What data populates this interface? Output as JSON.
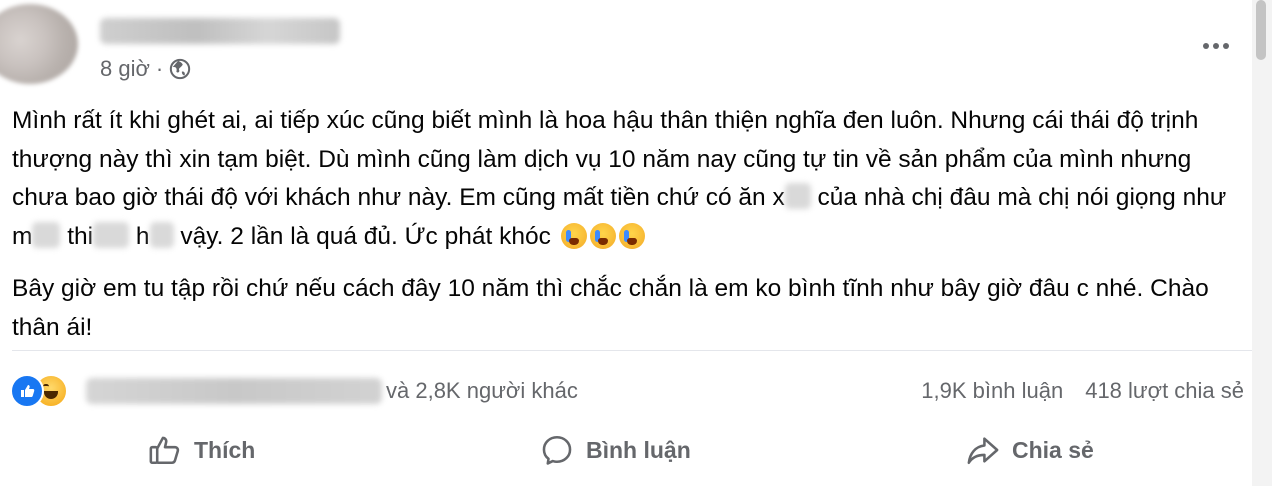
{
  "post": {
    "time": "8 giờ",
    "dot": "·",
    "paragraphs": {
      "p1a": "Mình rất ít khi ghét ai, ai tiếp xúc cũng biết mình là hoa hậu thân thiện nghĩa đen luôn. Nhưng cái thái độ trịnh thượng này thì xin tạm biệt. Dù mình cũng làm dịch vụ 10 năm nay cũng tự tin về sản phẩm của mình nhưng chưa bao giờ thái độ với khách như này. Em cũng mất tiền chứ có ăn x",
      "p1b": " của nhà chị đâu mà chị nói giọng như m",
      "p1c": " thi",
      "p1d": " h",
      "p1e": " vậy. 2 lần là quá đủ. Ức phát khóc",
      "p2": "Bây giờ em tu tập rồi chứ nếu cách đây 10 năm thì chắc chắn là em ko bình tĩnh như bây giờ đâu c nhé. Chào thân ái!"
    }
  },
  "reactions": {
    "others": "và 2,8K người khác",
    "comments": "1,9K bình luận",
    "shares": "418 lượt chia sẻ"
  },
  "actions": {
    "like": "Thích",
    "comment": "Bình luận",
    "share": "Chia sẻ"
  },
  "icons": {
    "globe": "globe-icon",
    "more": "more-icon",
    "like": "like-icon",
    "haha": "haha-icon",
    "cry": "crying-emoji-icon"
  },
  "colors": {
    "facebook_blue": "#1877f2",
    "secondary_text": "#65676b",
    "primary_text": "#050505"
  }
}
